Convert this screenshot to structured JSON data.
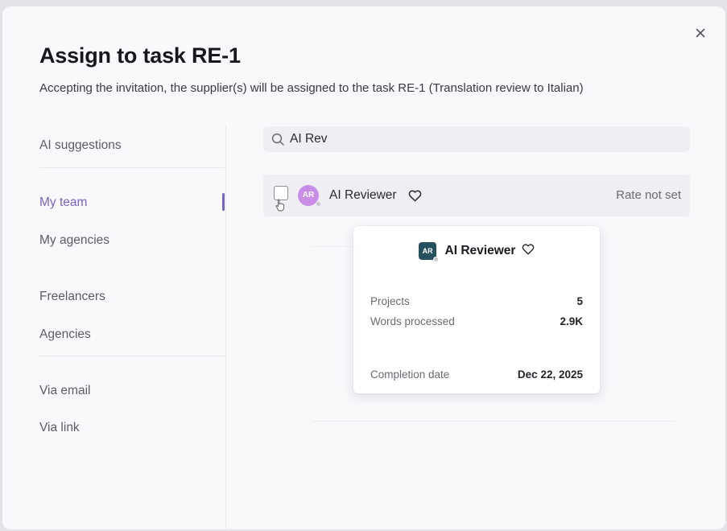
{
  "dialog": {
    "title": "Assign to task RE-1",
    "subtitle": "Accepting the invitation, the supplier(s) will be assigned to the task RE-1 (Translation review to Italian)",
    "close_icon": "close-icon"
  },
  "sidebar": {
    "items": [
      {
        "label": "AI suggestions"
      },
      {
        "label": "My team",
        "active": true
      },
      {
        "label": "My agencies"
      },
      {
        "label": "Freelancers"
      },
      {
        "label": "Agencies"
      },
      {
        "label": "Via email"
      },
      {
        "label": "Via link"
      }
    ],
    "accent_color": "#7763c5"
  },
  "search": {
    "value": "AI Rev",
    "icon": "search-icon"
  },
  "results": [
    {
      "initials": "AR",
      "name": "AI Reviewer",
      "rate": "Rate not set",
      "favorite_icon": "heart-outline-icon",
      "avatar_color": "#c98de8"
    }
  ],
  "tooltip": {
    "initials": "AR",
    "name": "AI Reviewer",
    "avatar_color": "#27505e",
    "stats": [
      {
        "label": "Projects",
        "value": "5"
      },
      {
        "label": "Words processed",
        "value": "2.9K"
      },
      {
        "label": "Completion date",
        "value": "Dec 22, 2025"
      }
    ]
  }
}
